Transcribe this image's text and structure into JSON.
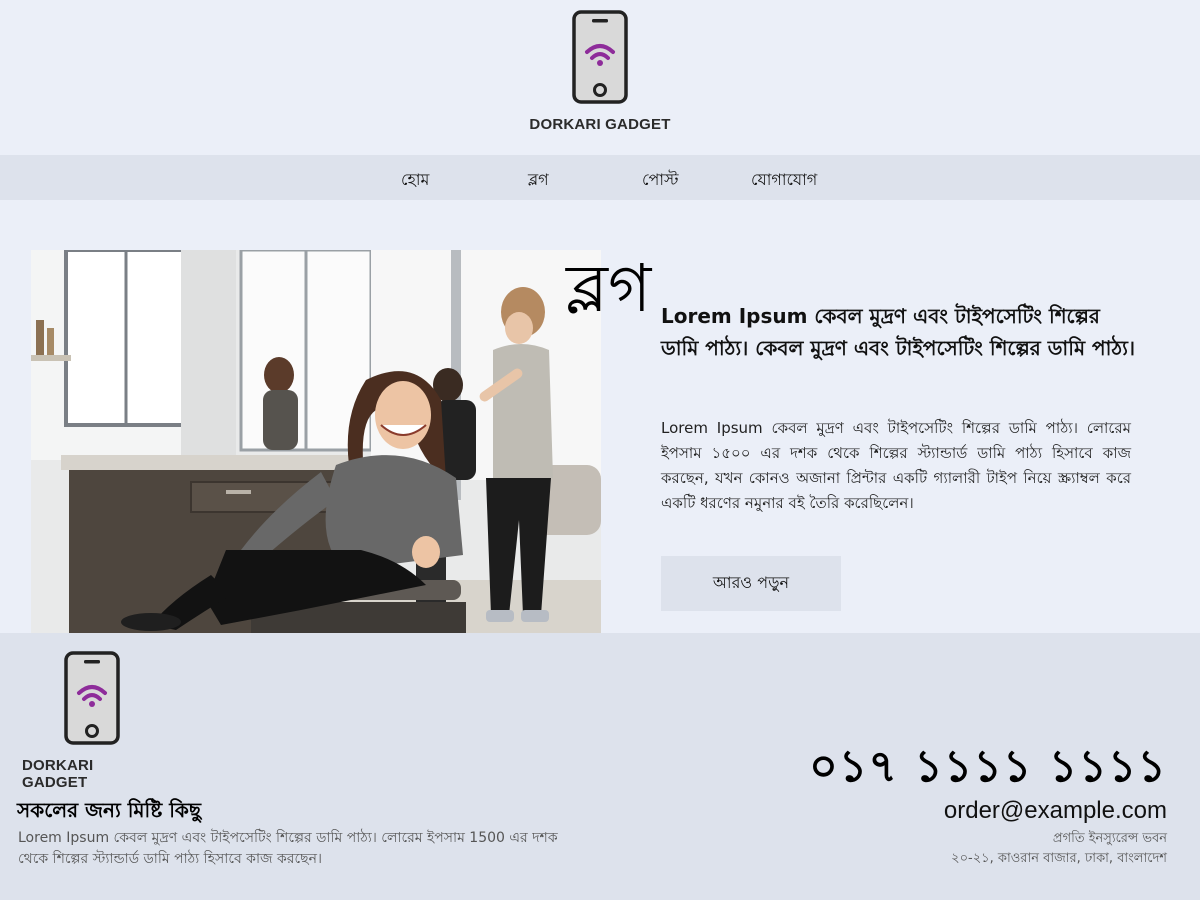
{
  "brand": {
    "name": "DORKARI GADGET",
    "logo_icon": "smartphone-wifi-icon",
    "accent_color": "#8e2c9a"
  },
  "nav": {
    "items": [
      {
        "label": "হোম"
      },
      {
        "label": "ব্লগ"
      },
      {
        "label": "পোস্ট"
      },
      {
        "label": "যোগাযোগ"
      }
    ]
  },
  "main": {
    "image_alt_icon": "salon-photo",
    "section_title": "ব্লগ",
    "headline": "Lorem Ipsum কেবল মুদ্রণ এবং টাইপসেটিং শিল্পের ডামি পাঠ্য। কেবল মুদ্রণ এবং টাইপসেটিং শিল্পের ডামি পাঠ্য।",
    "body": "Lorem Ipsum কেবল মুদ্রণ এবং টাইপসেটিং শিল্পের ডামি পাঠ্য। লোরেম ইপসাম ১৫০০ এর দশক থেকে শিল্পের স্ট্যান্ডার্ড ডামি পাঠ্য হিসাবে কাজ করছেন, যখন কোনও অজানা প্রিন্টার একটি গ্যালারী টাইপ নিয়ে স্ক্র্যাম্বল করে একটি ধরণের নমুনার বই তৈরি করেছিলেন।",
    "read_more": "আরও পড়ুন"
  },
  "footer": {
    "tagline": "সকলের জন্য মিষ্টি কিছু",
    "description": "Lorem Ipsum কেবল মুদ্রণ এবং টাইপসেটিং শিল্পের ডামি পাঠ্য। লোরেম ইপসাম 1500 এর দশক থেকে শিল্পের স্ট্যান্ডার্ড ডামি পাঠ্য হিসাবে কাজ করছেন।",
    "phone": "০১৭ ১১১১ ১১১১",
    "email": "order@example.com",
    "address_line1": "প্রগতি ইনস্যুরেন্স ভবন",
    "address_line2": "২০-২১, কাওরান বাজার, ঢাকা, বাংলাদেশ"
  }
}
